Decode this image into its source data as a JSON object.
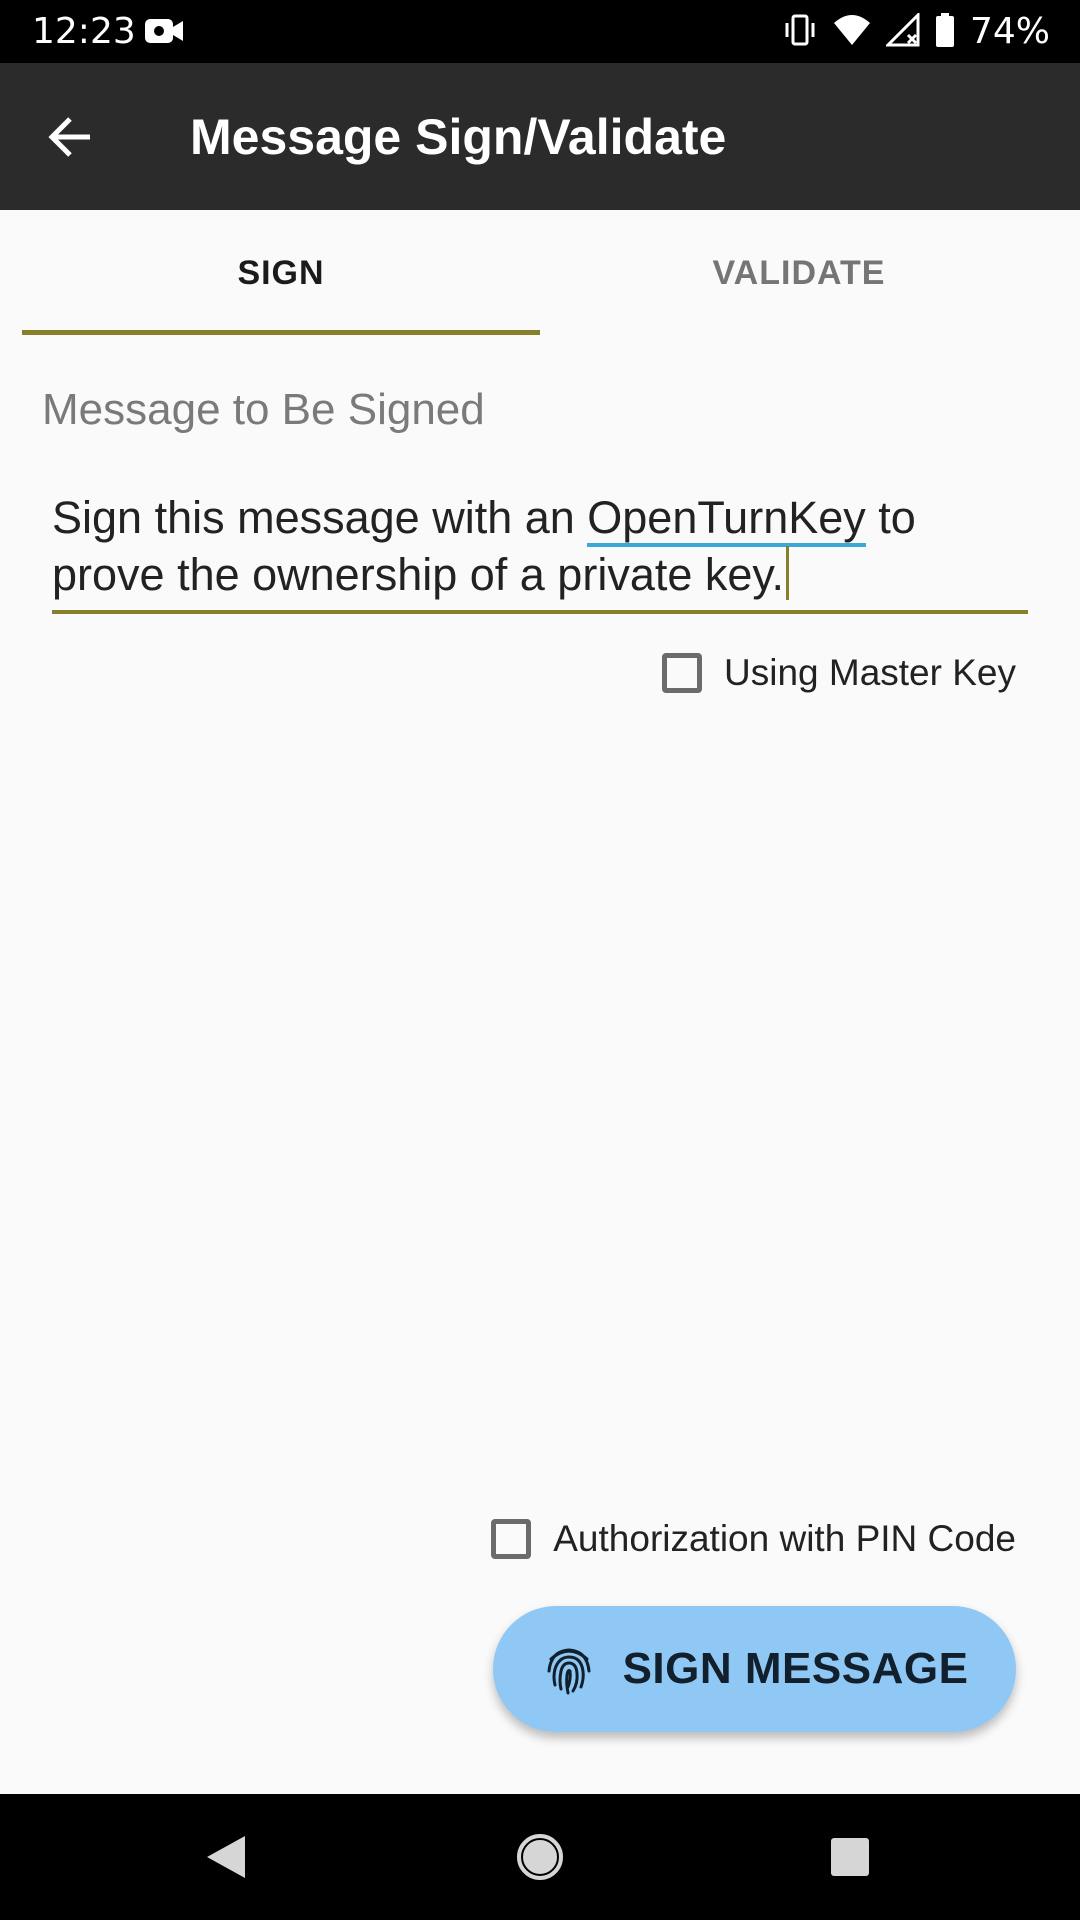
{
  "status_bar": {
    "time": "12:23",
    "battery_percent": "74%",
    "icons": [
      "camera-icon",
      "vibrate-icon",
      "wifi-icon",
      "signal-icon",
      "battery-icon"
    ]
  },
  "app_bar": {
    "title": "Message Sign/Validate",
    "back_icon": "arrow-back-icon"
  },
  "tabs": [
    {
      "label": "SIGN",
      "selected": true
    },
    {
      "label": "VALIDATE",
      "selected": false
    }
  ],
  "message_field": {
    "label": "Message to Be Signed",
    "line1_before": "Sign this message with an ",
    "line1_misspelled": "OpenTurnKey",
    "line1_after": " to",
    "line2": "prove the ownership of a private key."
  },
  "master_key_checkbox": {
    "label": "Using Master Key",
    "checked": false
  },
  "pin_checkbox": {
    "label": "Authorization with PIN Code",
    "checked": false
  },
  "sign_button": {
    "label": "SIGN MESSAGE",
    "icon": "fingerprint-icon"
  },
  "colors": {
    "accent": "#86802a",
    "app_bar": "#2b2b2b",
    "button": "#90c8f5",
    "spellcheck": "#3aa8d8"
  }
}
